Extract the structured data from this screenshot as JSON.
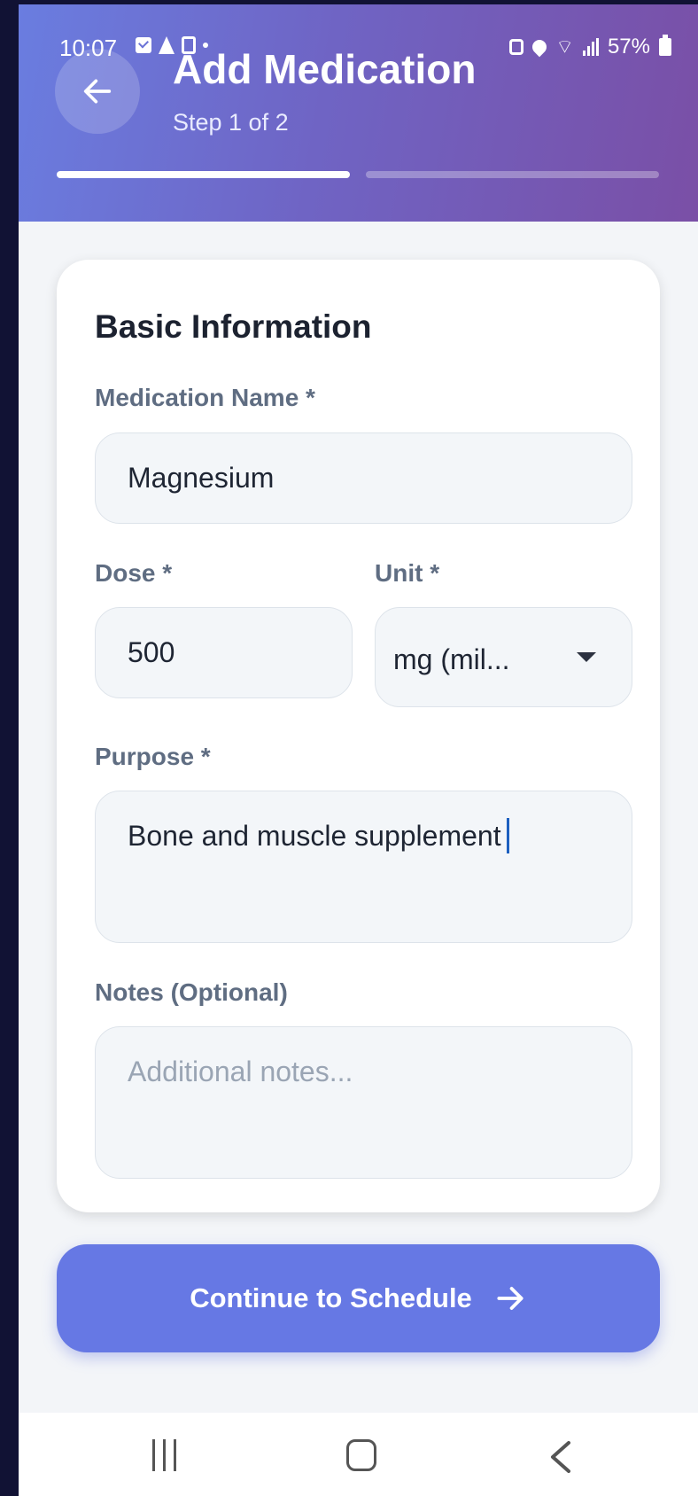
{
  "status_bar": {
    "time": "10:07",
    "battery": "57%",
    "icons_left": [
      "checkbox-icon",
      "navigation-icon",
      "phone-icon",
      "dot-icon"
    ],
    "icons_right": [
      "lock-icon",
      "location-icon",
      "wifi-icon",
      "signal-icon",
      "battery-icon"
    ]
  },
  "header": {
    "title": "Add Medication",
    "subtitle": "Step 1 of 2",
    "progress_steps": 2,
    "progress_current": 1,
    "gradient_start": "#6a7de0",
    "gradient_end": "#7a4fa6"
  },
  "card": {
    "title": "Basic Information",
    "medication_name": {
      "label": "Medication Name *",
      "value": "Magnesium"
    },
    "dose": {
      "label": "Dose *",
      "value": "500"
    },
    "unit": {
      "label": "Unit *",
      "value": "mg (mil..."
    },
    "purpose": {
      "label": "Purpose *",
      "value": "Bone and muscle supplement"
    },
    "notes": {
      "label": "Notes (Optional)",
      "placeholder": "Additional notes..."
    }
  },
  "continue_button": {
    "label": "Continue to Schedule",
    "color": "#6678e4"
  }
}
